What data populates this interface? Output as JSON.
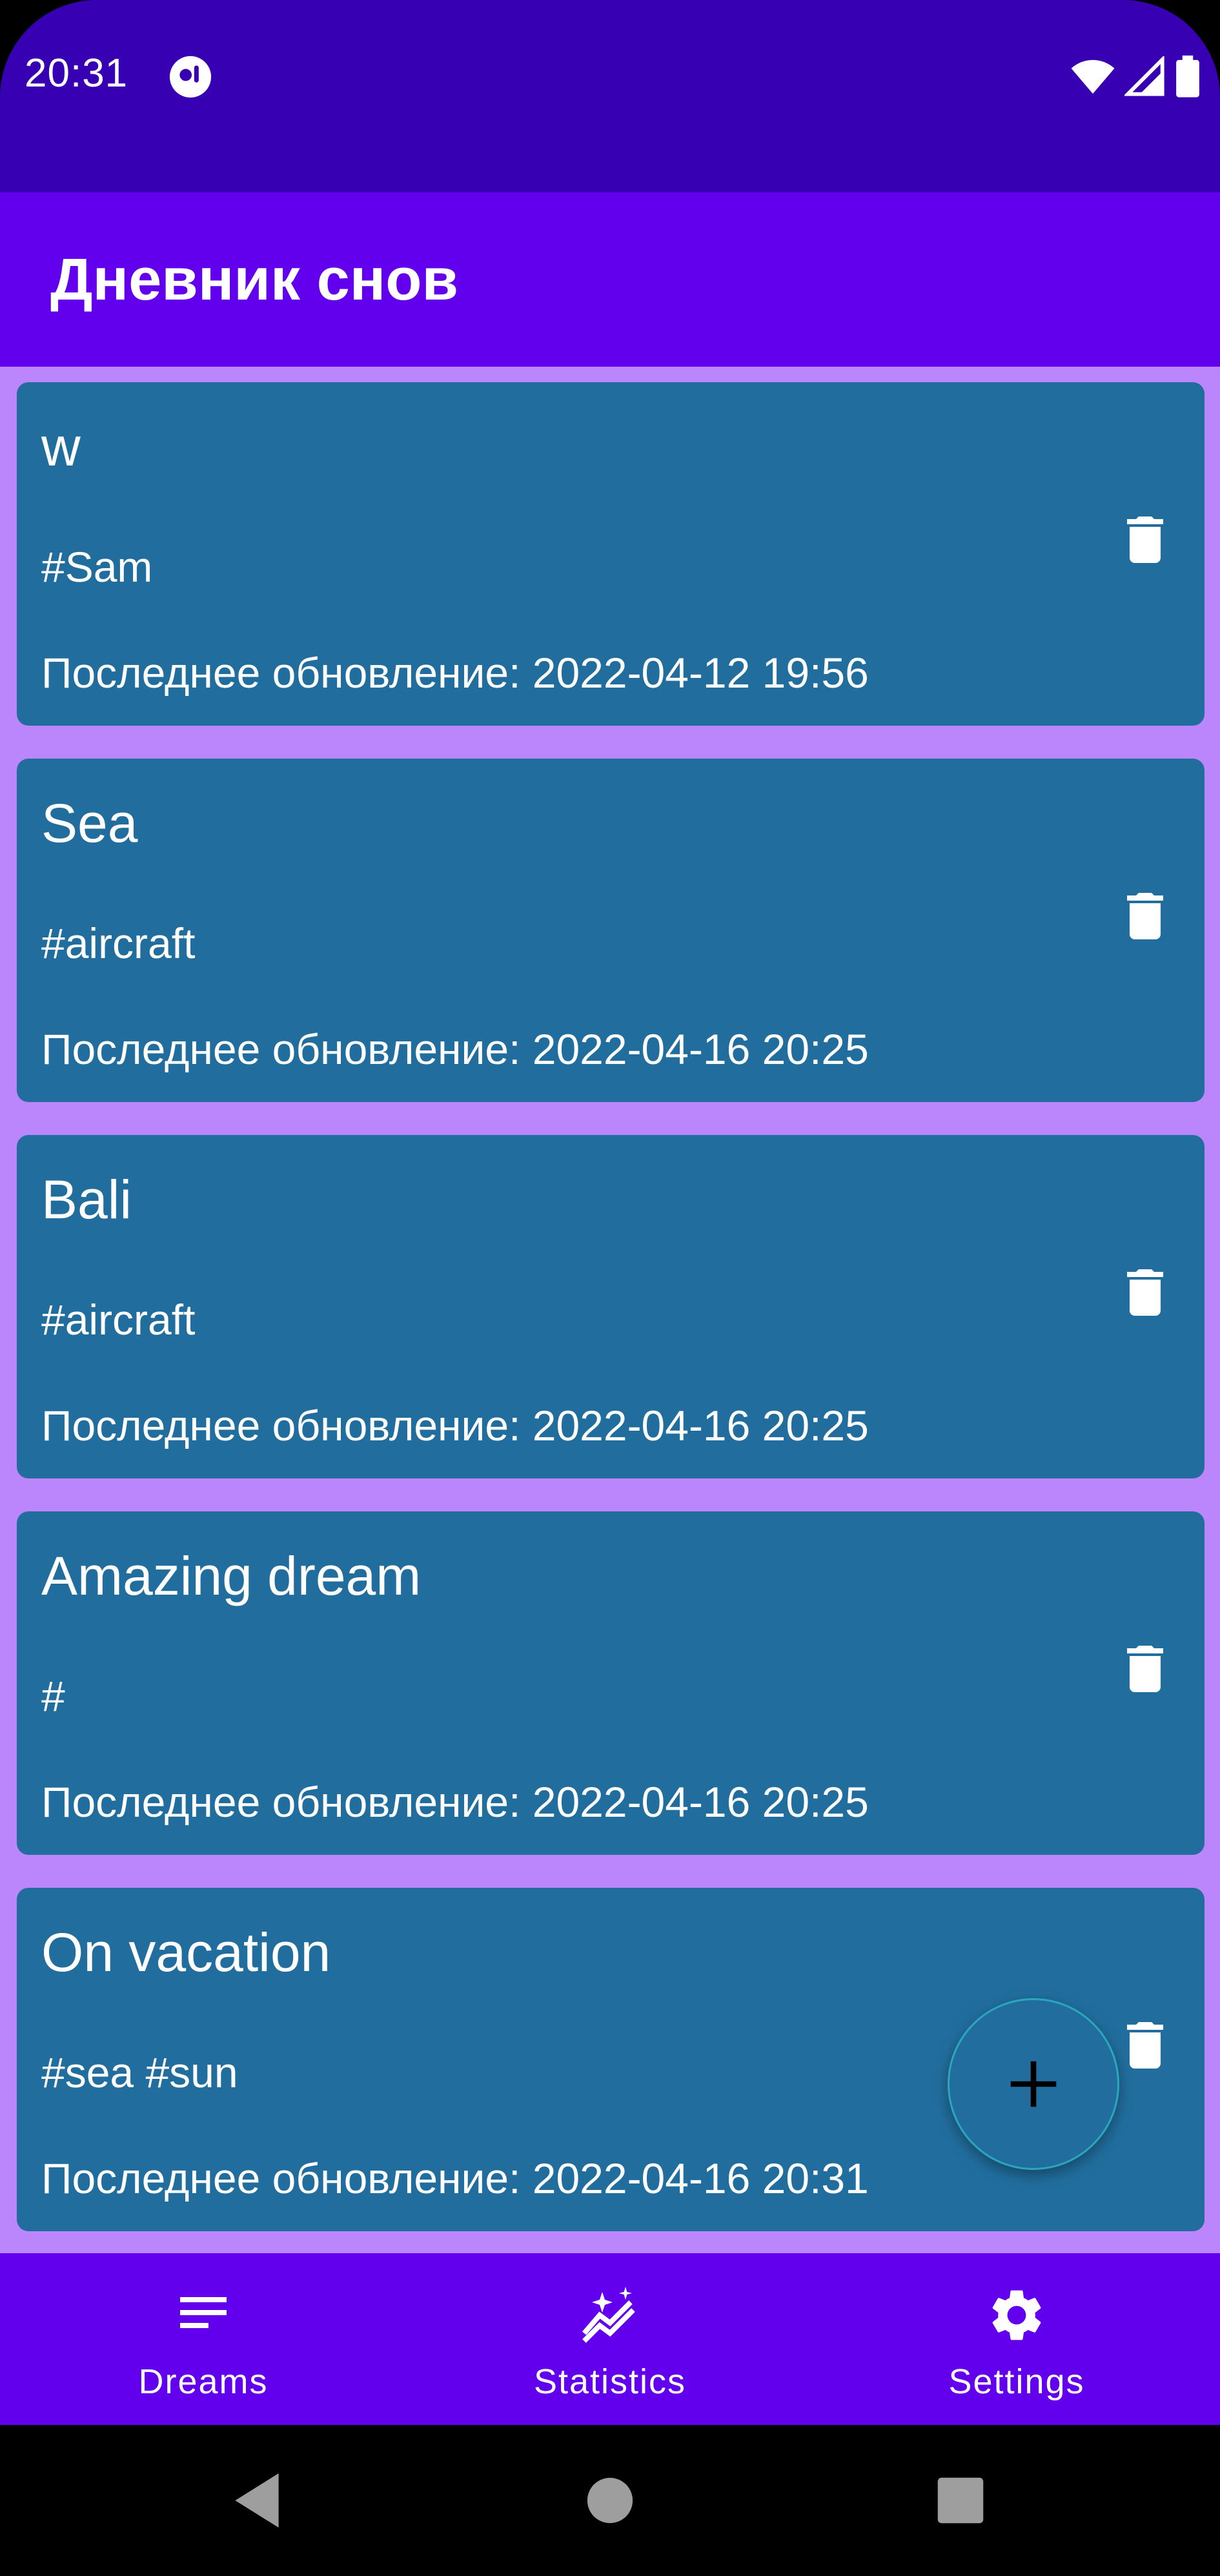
{
  "status_bar": {
    "time": "20:31",
    "app_icon": "assistant-icon",
    "wifi_icon": "wifi-icon",
    "signal_icon": "cell-signal-icon",
    "battery_icon": "battery-icon",
    "color": "#3700b3"
  },
  "app_bar": {
    "title": "Дневник снов",
    "color": "#6200ee"
  },
  "list": {
    "background": "#bb86fc",
    "card_color": "#216e9e",
    "delete_icon": "trash-icon",
    "items": [
      {
        "title": "w",
        "tags": "#Sam",
        "updated": "Последнее обновление: 2022-04-12 19:56"
      },
      {
        "title": "Sea",
        "tags": "#aircraft",
        "updated": "Последнее обновление: 2022-04-16 20:25"
      },
      {
        "title": "Bali",
        "tags": "#aircraft",
        "updated": "Последнее обновление: 2022-04-16 20:25"
      },
      {
        "title": "Amazing dream",
        "tags": "#",
        "updated": "Последнее обновление: 2022-04-16 20:25"
      },
      {
        "title": "On vacation",
        "tags": "#sea #sun",
        "updated": "Последнее обновление: 2022-04-16 20:31"
      }
    ]
  },
  "fab": {
    "icon": "plus-icon"
  },
  "bottom_nav": {
    "items": [
      {
        "label": "Dreams",
        "icon": "list-icon"
      },
      {
        "label": "Statistics",
        "icon": "auto-graph-icon"
      },
      {
        "label": "Settings",
        "icon": "gear-icon"
      }
    ]
  },
  "system_nav": {
    "back": "back-icon",
    "home": "home-icon",
    "recents": "recents-icon"
  }
}
